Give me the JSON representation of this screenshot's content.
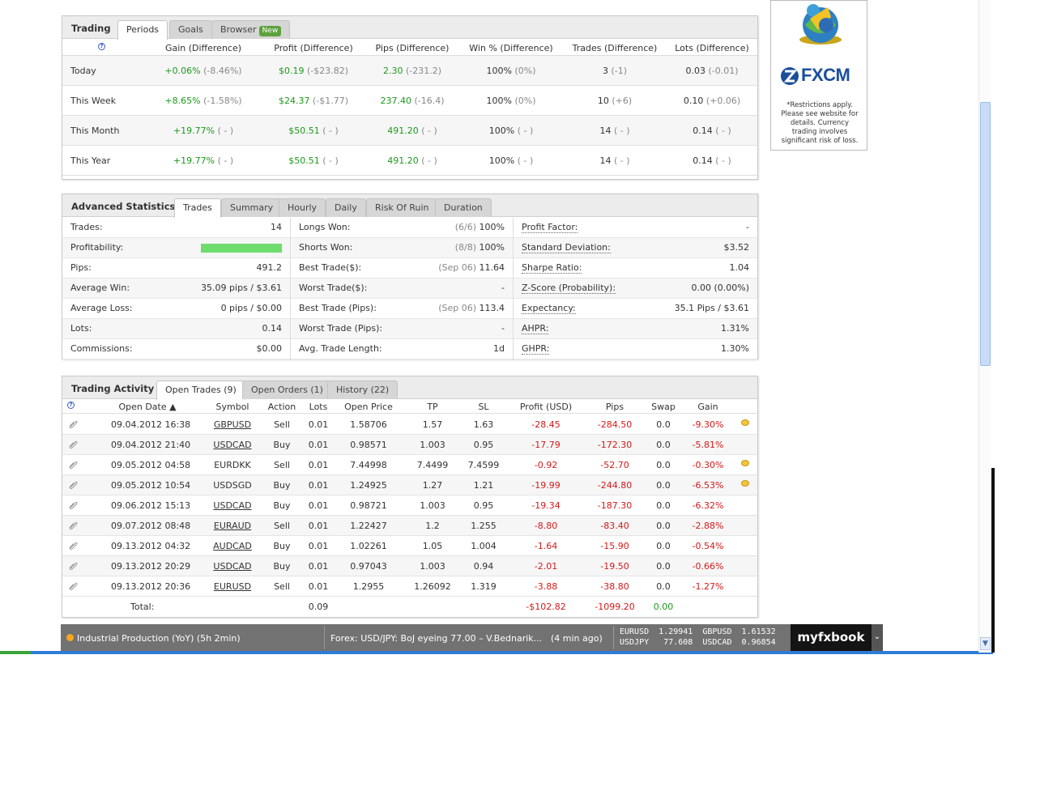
{
  "trading": {
    "title": "Trading",
    "tabs": [
      {
        "label": "Periods",
        "active": true
      },
      {
        "label": "Goals"
      },
      {
        "label": "Browser",
        "badge": "New"
      }
    ],
    "headers": [
      "?",
      "Gain (Difference)",
      "Profit (Difference)",
      "Pips (Difference)",
      "Win % (Difference)",
      "Trades (Difference)",
      "Lots (Difference)"
    ],
    "rows": [
      {
        "period": "Today",
        "gain": "+0.06%",
        "gain_diff": "(-8.46%)",
        "profit": "$0.19",
        "profit_diff": "(-$23.82)",
        "pips": "2.30",
        "pips_diff": "(-231.2)",
        "win": "100%",
        "win_diff": "(0%)",
        "trades": "3",
        "trades_diff": "(-1)",
        "lots": "0.03",
        "lots_diff": "(-0.01)"
      },
      {
        "period": "This Week",
        "gain": "+8.65%",
        "gain_diff": "(-1.58%)",
        "profit": "$24.37",
        "profit_diff": "(-$1.77)",
        "pips": "237.40",
        "pips_diff": "(-16.4)",
        "win": "100%",
        "win_diff": "(0%)",
        "trades": "10",
        "trades_diff": "(+6)",
        "lots": "0.10",
        "lots_diff": "(+0.06)"
      },
      {
        "period": "This Month",
        "gain": "+19.77%",
        "gain_diff": "( - )",
        "profit": "$50.51",
        "profit_diff": "( - )",
        "pips": "491.20",
        "pips_diff": "( - )",
        "win": "100%",
        "win_diff": "( - )",
        "trades": "14",
        "trades_diff": "( - )",
        "lots": "0.14",
        "lots_diff": "( - )"
      },
      {
        "period": "This Year",
        "gain": "+19.77%",
        "gain_diff": "( - )",
        "profit": "$50.51",
        "profit_diff": "( - )",
        "pips": "491.20",
        "pips_diff": "( - )",
        "win": "100%",
        "win_diff": "( - )",
        "trades": "14",
        "trades_diff": "( - )",
        "lots": "0.14",
        "lots_diff": "( - )"
      }
    ]
  },
  "advanced": {
    "title": "Advanced Statistics",
    "tabs": [
      {
        "label": "Trades",
        "active": true
      },
      {
        "label": "Summary"
      },
      {
        "label": "Hourly"
      },
      {
        "label": "Daily"
      },
      {
        "label": "Risk Of Ruin"
      },
      {
        "label": "Duration"
      }
    ],
    "col1": [
      {
        "label": "Trades:",
        "value": "14"
      },
      {
        "label": "Profitability:",
        "value": "",
        "bar_fraction": 1.0
      },
      {
        "label": "Pips:",
        "value": "491.2"
      },
      {
        "label": "Average Win:",
        "value": "35.09 pips / $3.61"
      },
      {
        "label": "Average Loss:",
        "value": "0 pips / $0.00"
      },
      {
        "label": "Lots:",
        "value": "0.14"
      },
      {
        "label": "Commissions:",
        "value": "$0.00"
      }
    ],
    "col2": [
      {
        "label": "Longs Won:",
        "note": "(6/6)",
        "value": "100%"
      },
      {
        "label": "Shorts Won:",
        "note": "(8/8)",
        "value": "100%"
      },
      {
        "label": "Best Trade($):",
        "note": "(Sep 06)",
        "value": "11.64"
      },
      {
        "label": "Worst Trade($):",
        "note": "",
        "value": "-"
      },
      {
        "label": "Best Trade (Pips):",
        "note": "(Sep 06)",
        "value": "113.4"
      },
      {
        "label": "Worst Trade (Pips):",
        "note": "",
        "value": "-"
      },
      {
        "label": "Avg. Trade Length:",
        "note": "",
        "value": "1d"
      }
    ],
    "col3": [
      {
        "label": "Profit Factor:",
        "value": "-"
      },
      {
        "label": "Standard Deviation:",
        "value": "$3.52"
      },
      {
        "label": "Sharpe Ratio:",
        "value": "1.04"
      },
      {
        "label": "Z-Score (Probability):",
        "value": "0.00 (0.00%)"
      },
      {
        "label": "Expectancy:",
        "value": "35.1 Pips / $3.61"
      },
      {
        "label": "AHPR:",
        "value": "1.31%"
      },
      {
        "label": "GHPR:",
        "value": "1.30%"
      }
    ]
  },
  "activity": {
    "title": "Trading Activity",
    "tabs": [
      {
        "label": "Open Trades (9)",
        "active": true
      },
      {
        "label": "Open Orders (1)"
      },
      {
        "label": "History (22)"
      }
    ],
    "headers": [
      "?",
      "Open Date ▲",
      "Symbol",
      "Action",
      "Lots",
      "Open Price",
      "TP",
      "SL",
      "Profit (USD)",
      "Pips",
      "Swap",
      "Gain"
    ],
    "rows": [
      {
        "date": "09.04.2012 16:38",
        "symbol": "GBPUSD",
        "sym_link": true,
        "action": "Sell",
        "lots": "0.01",
        "price": "1.58706",
        "tp": "1.57",
        "sl": "1.63",
        "profit": "-28.45",
        "pips": "-284.50",
        "swap": "0.0",
        "gain": "-9.30%",
        "comment": true
      },
      {
        "date": "09.04.2012 21:40",
        "symbol": "USDCAD",
        "sym_link": true,
        "action": "Buy",
        "lots": "0.01",
        "price": "0.98571",
        "tp": "1.003",
        "sl": "0.95",
        "profit": "-17.79",
        "pips": "-172.30",
        "swap": "0.0",
        "gain": "-5.81%",
        "comment": false
      },
      {
        "date": "09.05.2012 04:58",
        "symbol": "EURDKK",
        "sym_link": false,
        "action": "Sell",
        "lots": "0.01",
        "price": "7.44998",
        "tp": "7.4499",
        "sl": "7.4599",
        "profit": "-0.92",
        "pips": "-52.70",
        "swap": "0.0",
        "gain": "-0.30%",
        "comment": true
      },
      {
        "date": "09.05.2012 10:54",
        "symbol": "USDSGD",
        "sym_link": false,
        "action": "Buy",
        "lots": "0.01",
        "price": "1.24925",
        "tp": "1.27",
        "sl": "1.21",
        "profit": "-19.99",
        "pips": "-244.80",
        "swap": "0.0",
        "gain": "-6.53%",
        "comment": true
      },
      {
        "date": "09.06.2012 15:13",
        "symbol": "USDCAD",
        "sym_link": true,
        "action": "Buy",
        "lots": "0.01",
        "price": "0.98721",
        "tp": "1.003",
        "sl": "0.95",
        "profit": "-19.34",
        "pips": "-187.30",
        "swap": "0.0",
        "gain": "-6.32%",
        "comment": false
      },
      {
        "date": "09.07.2012 08:48",
        "symbol": "EURAUD",
        "sym_link": true,
        "action": "Sell",
        "lots": "0.01",
        "price": "1.22427",
        "tp": "1.2",
        "sl": "1.255",
        "profit": "-8.80",
        "pips": "-83.40",
        "swap": "0.0",
        "gain": "-2.88%",
        "comment": false
      },
      {
        "date": "09.13.2012 04:32",
        "symbol": "AUDCAD",
        "sym_link": true,
        "action": "Buy",
        "lots": "0.01",
        "price": "1.02261",
        "tp": "1.05",
        "sl": "1.004",
        "profit": "-1.64",
        "pips": "-15.90",
        "swap": "0.0",
        "gain": "-0.54%",
        "comment": false
      },
      {
        "date": "09.13.2012 20:29",
        "symbol": "USDCAD",
        "sym_link": true,
        "action": "Buy",
        "lots": "0.01",
        "price": "0.97043",
        "tp": "1.003",
        "sl": "0.94",
        "profit": "-2.01",
        "pips": "-19.50",
        "swap": "0.0",
        "gain": "-0.66%",
        "comment": false
      },
      {
        "date": "09.13.2012 20:36",
        "symbol": "EURUSD",
        "sym_link": true,
        "action": "Sell",
        "lots": "0.01",
        "price": "1.2955",
        "tp": "1.26092",
        "sl": "1.319",
        "profit": "-3.88",
        "pips": "-38.80",
        "swap": "0.0",
        "gain": "-1.27%",
        "comment": false
      }
    ],
    "total": {
      "label": "Total:",
      "lots": "0.09",
      "profit": "-$102.82",
      "pips": "-1099.20",
      "swap": "0.00"
    }
  },
  "ad": {
    "brand": "FXCM",
    "disclaimer": "*Restrictions apply. Please see website for details. Currency trading involves significant risk of loss."
  },
  "ticker": {
    "event": "Industrial Production (YoY) (5h 2min)",
    "news": "Forex: USD/JPY: BoJ eyeing 77.00 – V.Bednarik...",
    "news_age": "(4 min ago)",
    "quotes": [
      {
        "pair": "EURUSD",
        "rate": "1.29941"
      },
      {
        "pair": "GBPUSD",
        "rate": "1.61532"
      },
      {
        "pair": "USDJPY",
        "rate": "77.608"
      },
      {
        "pair": "USDCAD",
        "rate": "0.96854"
      }
    ],
    "logo": "myfxbook"
  },
  "colors": {
    "accent_green": "#1a9a1a",
    "negative_red": "#d61818",
    "ticker_bg": "#6f6f6f",
    "bar_green": "#6fdc6f"
  }
}
